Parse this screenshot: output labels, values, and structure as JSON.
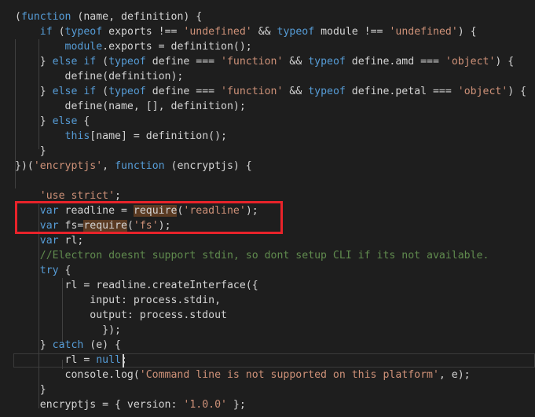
{
  "editor": {
    "lines": [
      [
        {
          "t": "(",
          "c": "p"
        },
        {
          "t": "function",
          "c": "k"
        },
        {
          "t": " (name, definition) {",
          "c": "p"
        }
      ],
      [
        {
          "t": "    ",
          "c": "p"
        },
        {
          "t": "if",
          "c": "k"
        },
        {
          "t": " (",
          "c": "p"
        },
        {
          "t": "typeof",
          "c": "k"
        },
        {
          "t": " exports !== ",
          "c": "p"
        },
        {
          "t": "'undefined'",
          "c": "s"
        },
        {
          "t": " && ",
          "c": "p"
        },
        {
          "t": "typeof",
          "c": "k"
        },
        {
          "t": " module !== ",
          "c": "p"
        },
        {
          "t": "'undefined'",
          "c": "s"
        },
        {
          "t": ") {",
          "c": "p"
        }
      ],
      [
        {
          "t": "        ",
          "c": "p"
        },
        {
          "t": "module",
          "c": "k"
        },
        {
          "t": ".exports = definition();",
          "c": "p"
        }
      ],
      [
        {
          "t": "    } ",
          "c": "p"
        },
        {
          "t": "else if",
          "c": "k"
        },
        {
          "t": " (",
          "c": "p"
        },
        {
          "t": "typeof",
          "c": "k"
        },
        {
          "t": " define === ",
          "c": "p"
        },
        {
          "t": "'function'",
          "c": "s"
        },
        {
          "t": " && ",
          "c": "p"
        },
        {
          "t": "typeof",
          "c": "k"
        },
        {
          "t": " define.amd === ",
          "c": "p"
        },
        {
          "t": "'object'",
          "c": "s"
        },
        {
          "t": ") {",
          "c": "p"
        }
      ],
      [
        {
          "t": "        define(definition);",
          "c": "p"
        }
      ],
      [
        {
          "t": "    } ",
          "c": "p"
        },
        {
          "t": "else if",
          "c": "k"
        },
        {
          "t": " (",
          "c": "p"
        },
        {
          "t": "typeof",
          "c": "k"
        },
        {
          "t": " define === ",
          "c": "p"
        },
        {
          "t": "'function'",
          "c": "s"
        },
        {
          "t": " && ",
          "c": "p"
        },
        {
          "t": "typeof",
          "c": "k"
        },
        {
          "t": " define.petal === ",
          "c": "p"
        },
        {
          "t": "'object'",
          "c": "s"
        },
        {
          "t": ") {",
          "c": "p"
        }
      ],
      [
        {
          "t": "        define(name, [], definition);",
          "c": "p"
        }
      ],
      [
        {
          "t": "    } ",
          "c": "p"
        },
        {
          "t": "else",
          "c": "k"
        },
        {
          "t": " {",
          "c": "p"
        }
      ],
      [
        {
          "t": "        ",
          "c": "p"
        },
        {
          "t": "this",
          "c": "k"
        },
        {
          "t": "[name] = definition();",
          "c": "p"
        }
      ],
      [
        {
          "t": "    }",
          "c": "p"
        }
      ],
      [
        {
          "t": "})(",
          "c": "p"
        },
        {
          "t": "'encryptjs'",
          "c": "s"
        },
        {
          "t": ", ",
          "c": "p"
        },
        {
          "t": "function",
          "c": "k"
        },
        {
          "t": " (encryptjs) {",
          "c": "p"
        }
      ],
      [
        {
          "t": "",
          "c": "p"
        }
      ],
      [
        {
          "t": "    ",
          "c": "p"
        },
        {
          "t": "'use strict'",
          "c": "s"
        },
        {
          "t": ";",
          "c": "p"
        }
      ],
      [
        {
          "t": "    ",
          "c": "p"
        },
        {
          "t": "var",
          "c": "k"
        },
        {
          "t": " readline = ",
          "c": "p"
        },
        {
          "t": "require",
          "c": "mh"
        },
        {
          "t": "(",
          "c": "p"
        },
        {
          "t": "'readline'",
          "c": "s"
        },
        {
          "t": ");",
          "c": "p"
        }
      ],
      [
        {
          "t": "    ",
          "c": "p"
        },
        {
          "t": "var",
          "c": "k"
        },
        {
          "t": " fs=",
          "c": "p"
        },
        {
          "t": "require",
          "c": "mh"
        },
        {
          "t": "(",
          "c": "p"
        },
        {
          "t": "'fs'",
          "c": "s"
        },
        {
          "t": ");",
          "c": "p"
        }
      ],
      [
        {
          "t": "    ",
          "c": "p"
        },
        {
          "t": "var",
          "c": "k"
        },
        {
          "t": " rl;",
          "c": "p"
        }
      ],
      [
        {
          "t": "    ",
          "c": "p"
        },
        {
          "t": "//Electron doesnt support stdin, so dont setup CLI if its not available.",
          "c": "c"
        }
      ],
      [
        {
          "t": "    ",
          "c": "p"
        },
        {
          "t": "try",
          "c": "k"
        },
        {
          "t": " {",
          "c": "p"
        }
      ],
      [
        {
          "t": "        rl = readline.createInterface({",
          "c": "p"
        }
      ],
      [
        {
          "t": "            input: process.stdin,",
          "c": "p"
        }
      ],
      [
        {
          "t": "            output: process.stdout",
          "c": "p"
        }
      ],
      [
        {
          "t": "              });",
          "c": "p"
        }
      ],
      [
        {
          "t": "    } ",
          "c": "p"
        },
        {
          "t": "catch",
          "c": "k"
        },
        {
          "t": " (e) {",
          "c": "p"
        }
      ],
      [
        {
          "t": "        rl = ",
          "c": "p"
        },
        {
          "t": "null",
          "c": "k"
        },
        {
          "t": ";",
          "c": "p"
        }
      ],
      [
        {
          "t": "        console.log(",
          "c": "p"
        },
        {
          "t": "'Command line is not supported on this platform'",
          "c": "s"
        },
        {
          "t": ", e);",
          "c": "p"
        }
      ],
      [
        {
          "t": "    }",
          "c": "p"
        }
      ],
      [
        {
          "t": "    encryptjs = { version: ",
          "c": "p"
        },
        {
          "t": "'1.0.0'",
          "c": "s"
        },
        {
          "t": " };",
          "c": "p"
        }
      ]
    ]
  },
  "colors": {
    "background": "#1e1e1e",
    "text": "#d4d4d4",
    "keyword": "#569cd6",
    "string": "#ce9178",
    "comment": "#608b4e",
    "match_highlight": "#5a3a22",
    "annotation_box": "#e8232a"
  }
}
